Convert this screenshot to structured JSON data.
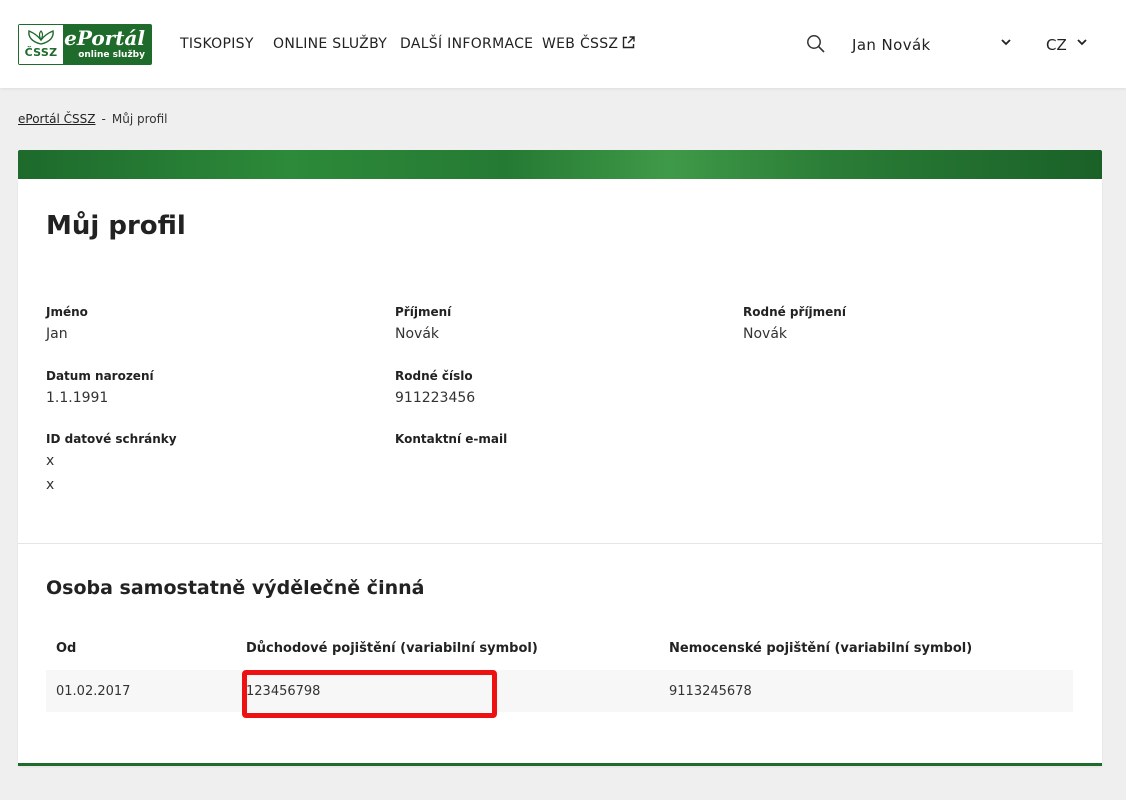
{
  "logo": {
    "left_text": "ČSSZ",
    "title": "ePortál",
    "subtitle": "online služby"
  },
  "nav": [
    {
      "label": "TISKOPISY"
    },
    {
      "label": "ONLINE SLUŽBY"
    },
    {
      "label": "DALŠÍ INFORMACE"
    },
    {
      "label": "WEB ČSSZ"
    }
  ],
  "header": {
    "user_name": "Jan Novák",
    "language": "CZ"
  },
  "breadcrumb": {
    "home": "ePortál ČSSZ",
    "separator": "-",
    "current": "Můj profil"
  },
  "profile": {
    "title": "Můj profil",
    "fields": {
      "first_name": {
        "label": "Jméno",
        "value": "Jan"
      },
      "last_name": {
        "label": "Příjmení",
        "value": "Novák"
      },
      "birth_surname": {
        "label": "Rodné příjmení",
        "value": "Novák"
      },
      "birth_date": {
        "label": "Datum narození",
        "value": "1.1.1991"
      },
      "birth_number": {
        "label": "Rodné číslo",
        "value": "911223456"
      },
      "data_box": {
        "label": "ID datové schránky",
        "value1": "x",
        "value2": "x"
      },
      "contact_email": {
        "label": "Kontaktní e-mail",
        "value": ""
      }
    }
  },
  "osvc": {
    "title": "Osoba samostatně výdělečně činná",
    "columns": [
      "Od",
      "Důchodové pojištění (variabilní symbol)",
      "Nemocenské pojištění (variabilní symbol)"
    ],
    "rows": [
      [
        "01.02.2017",
        "123456798",
        "9113245678"
      ]
    ]
  },
  "colors": {
    "brand_green": "#1f6b2b",
    "highlight_red": "#ee1111"
  },
  "icons": {
    "search": "search-icon",
    "user_menu": "chevron-down-icon",
    "language_menu": "chevron-down-icon",
    "external": "external-link-icon"
  }
}
